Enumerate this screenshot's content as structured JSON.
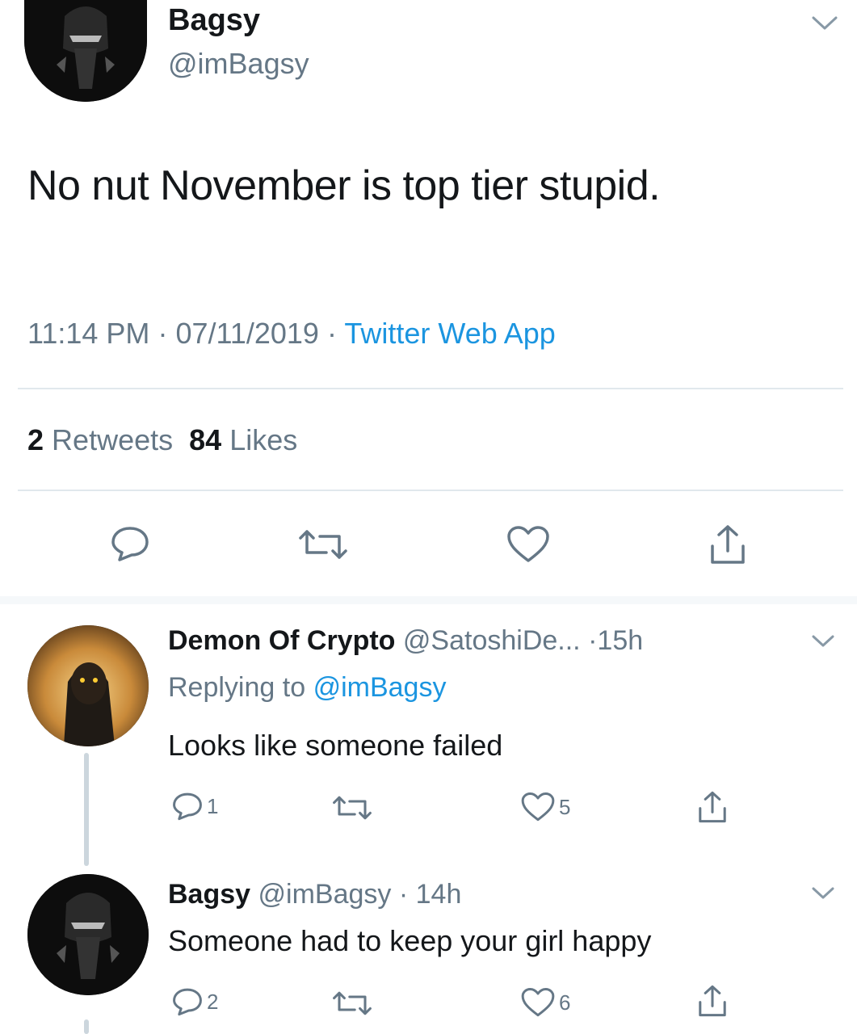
{
  "main_tweet": {
    "author_name": "Bagsy",
    "author_handle": "@imBagsy",
    "text": "No nut November is top tier stupid.",
    "time": "11:14 PM",
    "date": "07/11/2019",
    "separator": "·",
    "source": "Twitter Web App",
    "retweets_count": "2",
    "retweets_label": "Retweets",
    "likes_count": "84",
    "likes_label": "Likes"
  },
  "replies": [
    {
      "author_name": "Demon Of Crypto",
      "author_handle": "@SatoshiDe...",
      "age": "·15h",
      "replying_to_label": "Replying to",
      "replying_to_handle": "@imBagsy",
      "text": "Looks like someone failed",
      "reply_count": "1",
      "like_count": "5"
    },
    {
      "author_name": "Bagsy",
      "author_handle": "@imBagsy",
      "age": "· 14h",
      "text": "Someone had to keep your girl happy",
      "reply_count": "2",
      "like_count": "6"
    }
  ],
  "colors": {
    "text": "#14171a",
    "secondary": "#657786",
    "link": "#1b95e0",
    "divider": "#e1e8ed"
  },
  "icons": [
    "chevron-down-icon",
    "reply-icon",
    "retweet-icon",
    "like-icon",
    "share-icon"
  ]
}
